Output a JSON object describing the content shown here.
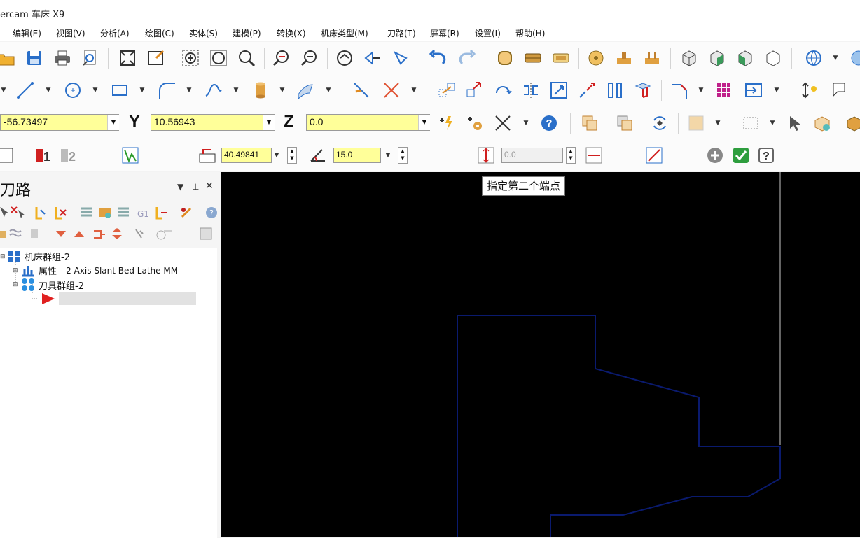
{
  "window": {
    "title": "ercam 车床 X9"
  },
  "menu": [
    "编辑(E)",
    "视图(V)",
    "分析(A)",
    "绘图(C)",
    "实体(S)",
    "建模(P)",
    "转换(X)",
    "机床类型(M)",
    "刀路(T)",
    "屏幕(R)",
    "设置(I)",
    "帮助(H)"
  ],
  "coords": {
    "x_value": "-56.73497",
    "y_label": "Y",
    "y_value": "10.56943",
    "z_label": "Z",
    "z_value": "0.0"
  },
  "ribbon": {
    "length_value": "40.49841",
    "angle_value": "15.0",
    "third_value": "0.0"
  },
  "panel": {
    "title": "刀路",
    "tree": {
      "root": "机床群组-2",
      "properties_label": "属性",
      "properties_value": "- 2 Axis Slant Bed Lathe MM",
      "toolgroup": "刀具群组-2"
    }
  },
  "viewport": {
    "tooltip": "指定第二个端点"
  },
  "colors": {
    "field_bg": "#ffff99",
    "viewport_bg": "#000000",
    "geometry_line": "#0a1a6e"
  }
}
